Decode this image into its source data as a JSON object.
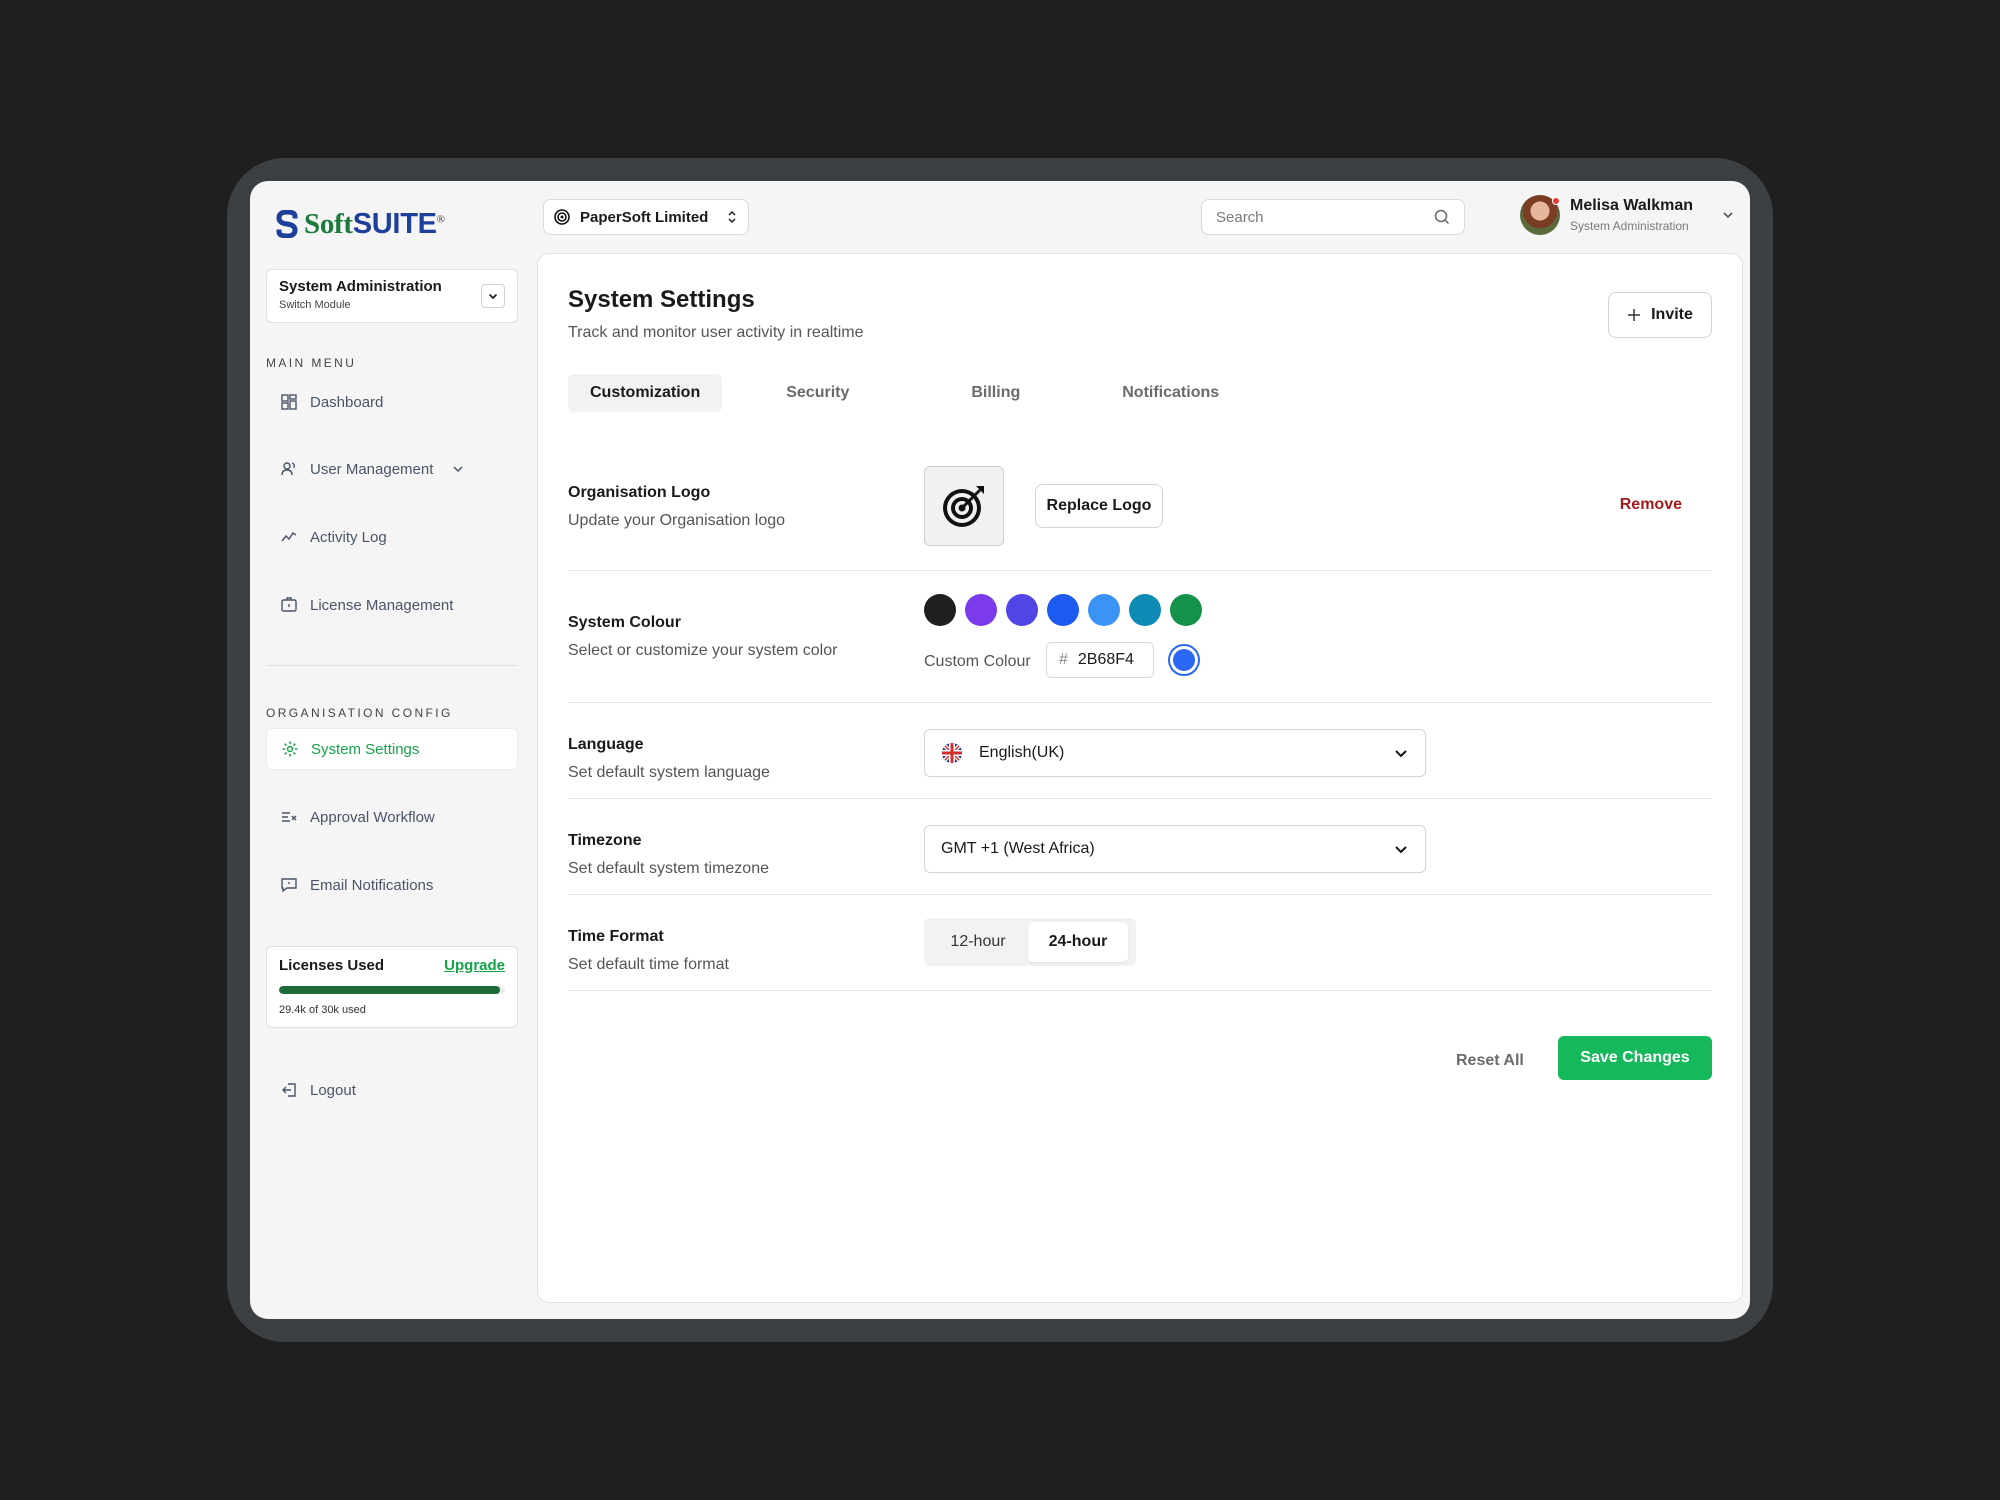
{
  "brand": {
    "name_part1": "Soft",
    "name_part2": "SUITE",
    "registered": "®"
  },
  "org_switcher": {
    "label": "PaperSoft Limited"
  },
  "search": {
    "placeholder": "Search"
  },
  "user": {
    "name": "Melisa Walkman",
    "role": "System Administration"
  },
  "sidebar": {
    "module": {
      "title": "System Administration",
      "subtitle": "Switch Module"
    },
    "main_menu_label": "MAIN MENU",
    "main_menu": [
      {
        "label": "Dashboard",
        "icon": "grid-icon"
      },
      {
        "label": "User Management",
        "icon": "users-icon"
      },
      {
        "label": "Activity Log",
        "icon": "activity-icon"
      },
      {
        "label": "License Management",
        "icon": "license-icon"
      }
    ],
    "org_config_label": "ORGANISATION CONFIG",
    "org_config": [
      {
        "label": "System Settings",
        "icon": "gear-icon",
        "active": true
      },
      {
        "label": "Approval Workflow",
        "icon": "workflow-icon"
      },
      {
        "label": "Email Notifications",
        "icon": "message-icon"
      }
    ],
    "licenses": {
      "title": "Licenses Used",
      "upgrade": "Upgrade",
      "used_text": "29.4k of 30k used",
      "used_fraction": 0.98
    },
    "logout": "Logout"
  },
  "page": {
    "title": "System Settings",
    "subtitle": "Track and monitor user activity in realtime",
    "invite_label": "Invite",
    "tabs": [
      "Customization",
      "Security",
      "Billing",
      "Notifications"
    ],
    "active_tab": "Customization"
  },
  "settings": {
    "logo": {
      "label": "Organisation Logo",
      "desc": "Update your Organisation logo",
      "replace": "Replace Logo",
      "remove": "Remove"
    },
    "colour": {
      "label": "System Colour",
      "desc": "Select or customize your system color",
      "swatches": [
        "#1f1f1f",
        "#7c3aed",
        "#4f46e5",
        "#1d5bf0",
        "#3b93f5",
        "#0e8bb5",
        "#14924a"
      ],
      "custom_label": "Custom Colour",
      "hash": "#",
      "custom_value": "2B68F4",
      "custom_hex": "#2b68f4"
    },
    "language": {
      "label": "Language",
      "desc": "Set default system language",
      "value": "English(UK)"
    },
    "timezone": {
      "label": "Timezone",
      "desc": "Set default system timezone",
      "value": "GMT +1 (West Africa)"
    },
    "time_format": {
      "label": "Time Format",
      "desc": "Set default time format",
      "options": [
        "12-hour",
        "24-hour"
      ],
      "selected": "24-hour"
    }
  },
  "actions": {
    "reset": "Reset All",
    "save": "Save Changes"
  },
  "colors": {
    "accent": "#16b85c",
    "danger": "#a31b1b",
    "brand_green": "#1c7a3a",
    "brand_blue": "#1e3f9b"
  }
}
